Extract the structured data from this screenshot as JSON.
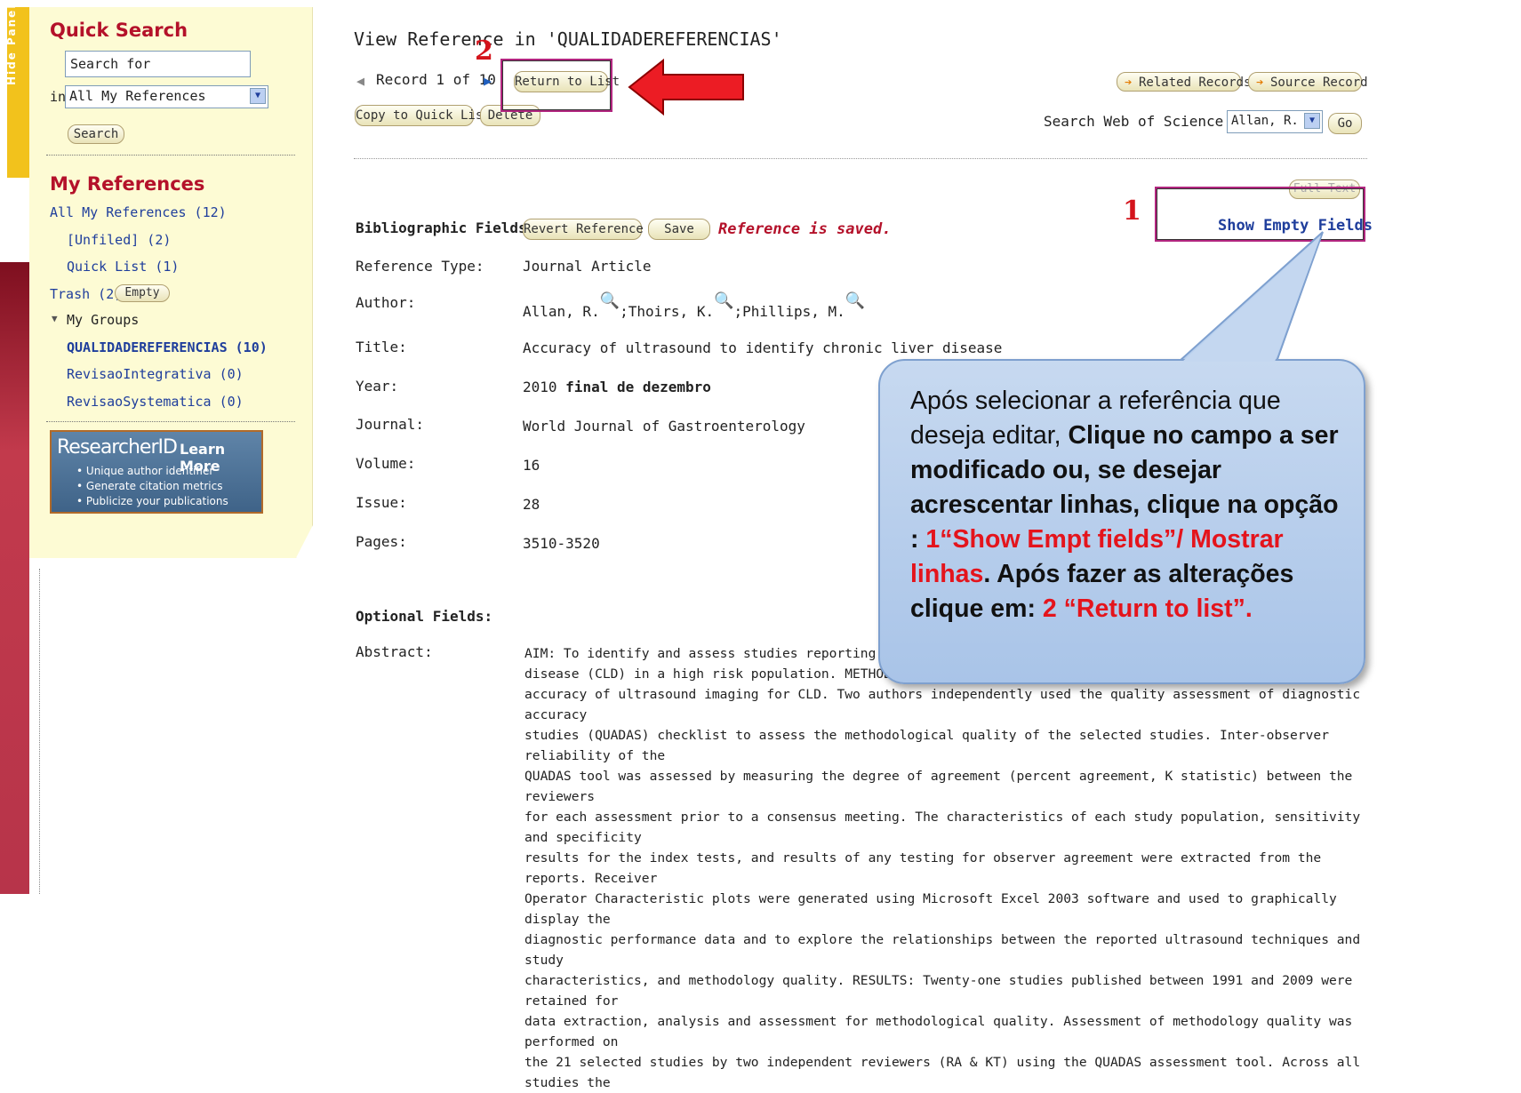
{
  "side_tab": {
    "label": "Hide Panel"
  },
  "quick_search": {
    "title": "Quick Search",
    "search_placeholder": "Search for",
    "in_label": "in",
    "scope_selected": "All My References",
    "search_button": "Search"
  },
  "my_references": {
    "title": "My References",
    "all": "All My References (12)",
    "unfiled": "[Unfiled] (2)",
    "quick_list": "Quick List (1)",
    "trash": "Trash (2)",
    "empty_button": "Empty",
    "my_groups": "My Groups",
    "groups": [
      "QUALIDADEREFERENCIAS (10)",
      "RevisaoIntegrativa (0)",
      "RevisaoSystematica (0)"
    ]
  },
  "researcher_id": {
    "logo": "ResearcherID",
    "learn_more": "Learn More",
    "bullets": [
      "Unique author identifier",
      "Generate citation metrics",
      "Publicize your publications"
    ]
  },
  "header": {
    "title": "View Reference in 'QUALIDADEREFERENCIAS'",
    "record": "Record 1 of 10",
    "return_button": "Return to List",
    "copy_button": "Copy to Quick List",
    "delete_button": "Delete",
    "related_button": "Related Records",
    "source_button": "Source Record",
    "search_wos_label": "Search Web of Science for",
    "search_wos_selected": "Allan, R.",
    "go_button": "Go",
    "full_text_button": "Full Text",
    "show_empty": "Show Empty Fields"
  },
  "bibliographic": {
    "label": "Bibliographic Fields:",
    "revert_button": "Revert Reference",
    "save_button": "Save",
    "status": "Reference is saved."
  },
  "fields": {
    "reference_type": {
      "label": "Reference Type:",
      "value": "Journal Article"
    },
    "author": {
      "label": "Author:",
      "authors": [
        "Allan, R.",
        ";Thoirs, K.",
        ";Phillips, M."
      ]
    },
    "title": {
      "label": "Title:",
      "value": "Accuracy of ultrasound to identify chronic liver disease"
    },
    "year": {
      "label": "Year:",
      "value": "2010",
      "extra": "final de dezembro"
    },
    "journal": {
      "label": "Journal:",
      "value": "World Journal of Gastroenterology"
    },
    "volume": {
      "label": "Volume:",
      "value": "16"
    },
    "issue": {
      "label": "Issue:",
      "value": "28"
    },
    "pages": {
      "label": "Pages:",
      "value": "3510-3520"
    }
  },
  "optional": {
    "label": "Optional Fields:",
    "abstract_label": "Abstract:",
    "abstract_lines": [
      "AIM: To identify and assess studies reporting the diag",
      "disease (CLD) in a high risk population. METHODS: A s",
      "accuracy of ultrasound imaging for CLD. Two authors independently used the quality assessment of diagnostic accuracy",
      "studies (QUADAS) checklist to assess the methodological quality of the selected studies. Inter-observer reliability of the",
      "QUADAS tool was assessed by measuring the degree of agreement (percent agreement, K statistic) between the reviewers",
      "for each assessment prior to a consensus meeting. The characteristics of each study population, sensitivity and specificity",
      "results for the index tests, and results of any testing for observer agreement were extracted from the reports. Receiver",
      "Operator Characteristic plots were generated using Microsoft Excel 2003 software and used to graphically display the",
      "diagnostic performance data and to explore the relationships between the reported ultrasound techniques and study",
      "characteristics, and methodology quality. RESULTS: Twenty-one studies published between 1991 and 2009 were retained for",
      "data extraction, analysis and assessment for methodological quality. Assessment of methodology quality was performed on",
      "the 21 selected studies by two independent reviewers (RA & KT) using the QUADAS assessment tool. Across all studies the"
    ]
  },
  "annotations": {
    "marker_1": "1",
    "marker_2": "2",
    "callout_p1": "Após selecionar a referência que deseja editar, ",
    "callout_b1": "Clique no campo a ser modificado ou, se desejar acrescentar linhas, clique na opção : ",
    "callout_r1": "1“Show Empt fields”/ Mostrar linhas",
    "callout_b2": ".  Após fazer as alterações clique em: ",
    "callout_r2": "2 “Return to list”."
  },
  "colors": {
    "accent_red": "#b4112a",
    "link_blue": "#1f3e9c",
    "sidebar_bg": "#fdfbd4",
    "callout_bg": "#b8cfee"
  }
}
